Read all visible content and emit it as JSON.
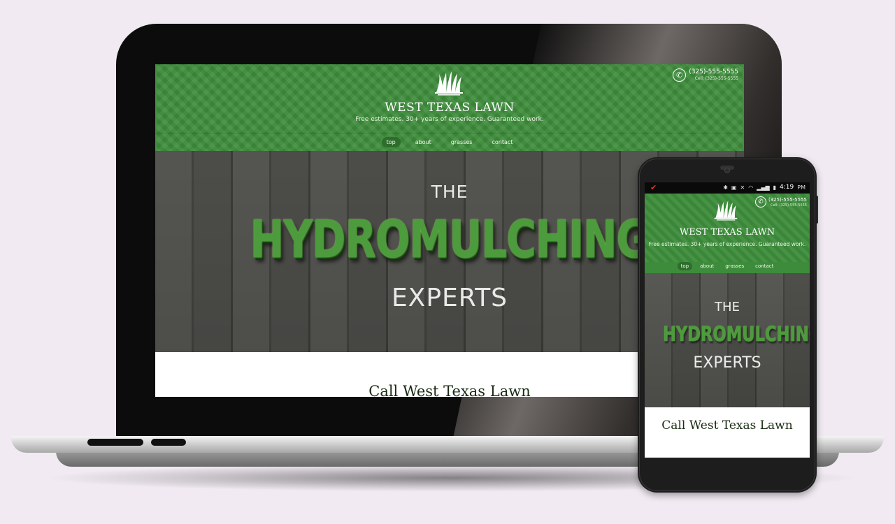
{
  "site": {
    "title": "WEST TEXAS LAWN",
    "tagline": "Free estimates. 30+ years of experience. Guaranteed work.",
    "phone_main": "(325)-555-5555",
    "phone_cell": "Cell: (325)-555-5555",
    "nav": [
      {
        "label": "top",
        "active": true
      },
      {
        "label": "about",
        "active": false
      },
      {
        "label": "grasses",
        "active": false
      },
      {
        "label": "contact",
        "active": false
      }
    ],
    "hero_the": "THE",
    "hero_big": "HYDROMULCHING",
    "hero_experts": "EXPERTS",
    "call_title": "Call West Texas Lawn"
  },
  "phone_status": {
    "time": "4:19",
    "ampm": "PM"
  },
  "icons": {
    "logo": "grass-logo-icon",
    "phone": "phone-icon",
    "status_check": "check-icon"
  },
  "colors": {
    "brand_green": "#3d8c3b",
    "nav_active": "#2e6e2c",
    "background": "#f1eaf2"
  }
}
